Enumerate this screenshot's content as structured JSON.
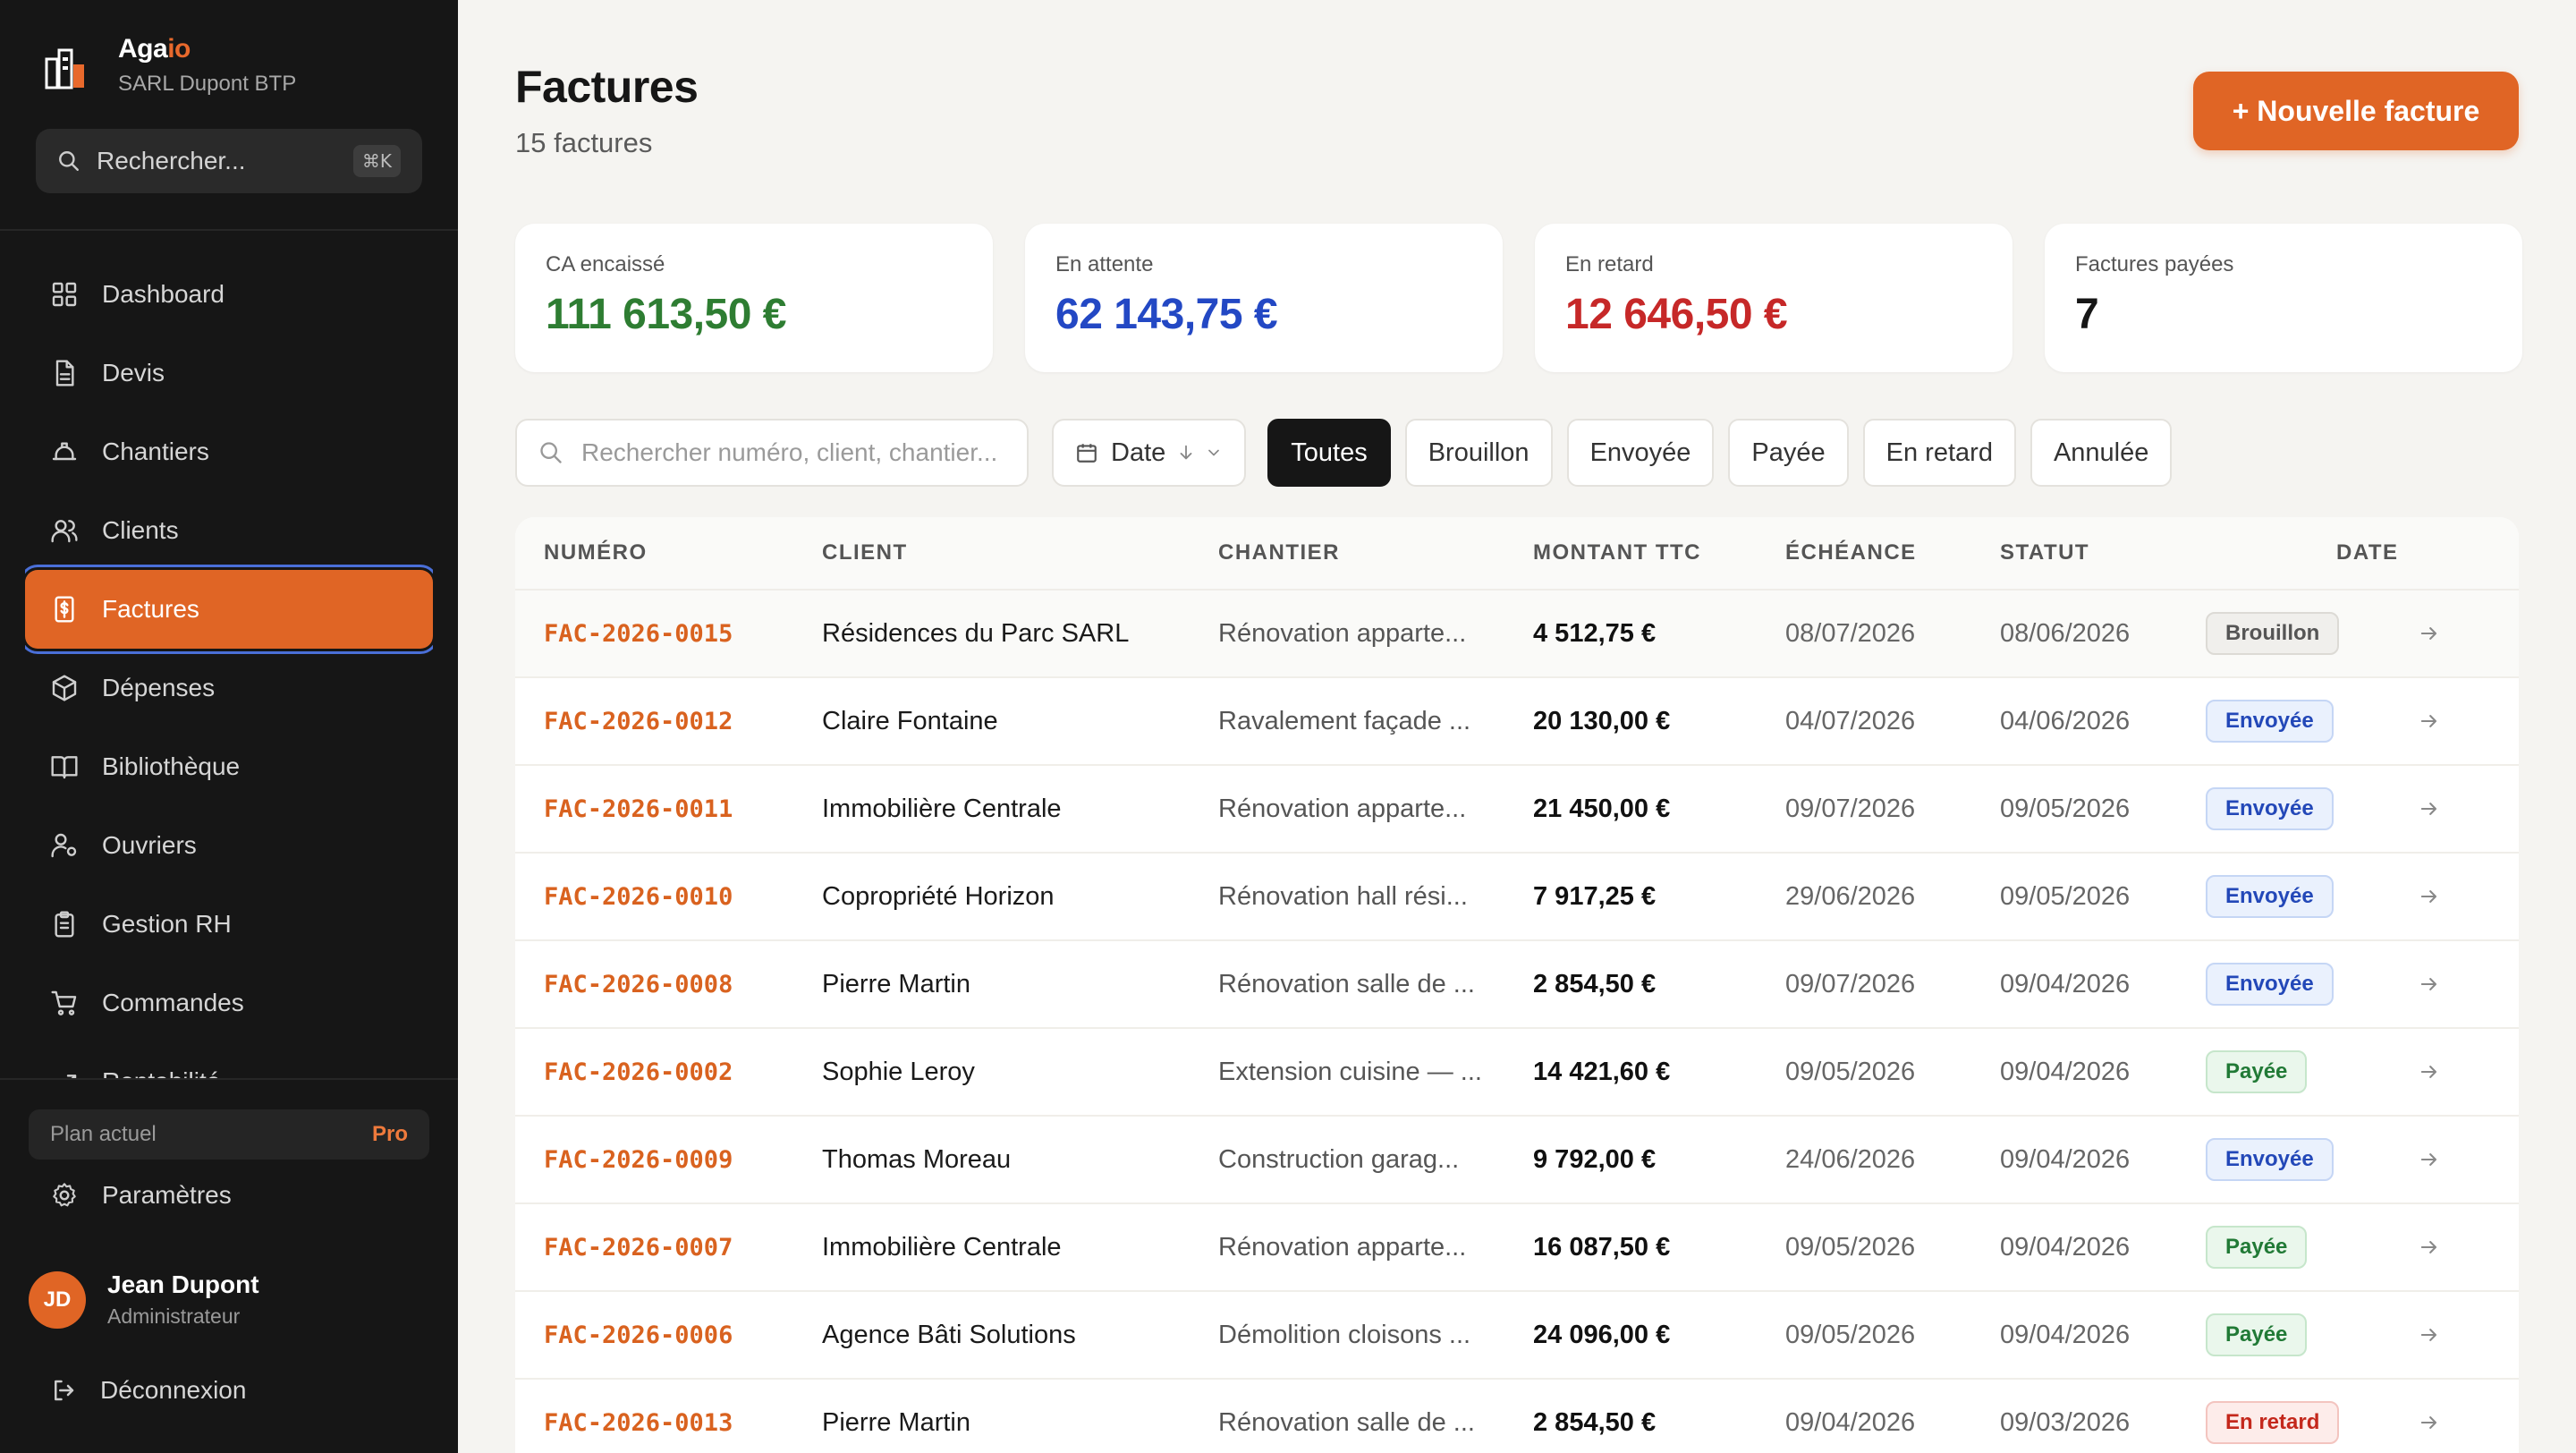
{
  "brand": {
    "name_main": "Aga",
    "name_accent": "io",
    "company": "SARL Dupont BTP"
  },
  "sidebar": {
    "search_label": "Rechercher...",
    "search_shortcut": "⌘K",
    "items": [
      {
        "label": "Dashboard",
        "icon": "grid-icon"
      },
      {
        "label": "Devis",
        "icon": "document-icon"
      },
      {
        "label": "Chantiers",
        "icon": "helmet-icon"
      },
      {
        "label": "Clients",
        "icon": "users-icon"
      },
      {
        "label": "Factures",
        "icon": "invoice-icon",
        "active": true
      },
      {
        "label": "Dépenses",
        "icon": "box-icon"
      },
      {
        "label": "Bibliothèque",
        "icon": "book-icon"
      },
      {
        "label": "Ouvriers",
        "icon": "worker-icon"
      },
      {
        "label": "Gestion RH",
        "icon": "clipboard-icon"
      },
      {
        "label": "Commandes",
        "icon": "cart-icon"
      },
      {
        "label": "Rentabilité",
        "icon": "chart-icon"
      }
    ],
    "plan_label": "Plan actuel",
    "plan_value": "Pro",
    "settings_label": "Paramètres",
    "user": {
      "initials": "JD",
      "name": "Jean Dupont",
      "role": "Administrateur"
    },
    "logout_label": "Déconnexion"
  },
  "header": {
    "title": "Factures",
    "subtitle": "15 factures",
    "new_button": "+ Nouvelle facture"
  },
  "stats": [
    {
      "label": "CA encaissé",
      "value": "111 613,50 €",
      "color": "#2e7d32"
    },
    {
      "label": "En attente",
      "value": "62 143,75 €",
      "color": "#2348c4"
    },
    {
      "label": "En retard",
      "value": "12 646,50 €",
      "color": "#c62828"
    },
    {
      "label": "Factures payées",
      "value": "7",
      "color": "#161616"
    }
  ],
  "filters": {
    "search_placeholder": "Rechercher numéro, client, chantier...",
    "date_label": "Date",
    "chips": [
      "Toutes",
      "Brouillon",
      "Envoyée",
      "Payée",
      "En retard",
      "Annulée"
    ],
    "active_chip": "Toutes"
  },
  "table": {
    "columns": [
      "NUMÉRO",
      "CLIENT",
      "CHANTIER",
      "MONTANT TTC",
      "ÉCHÉANCE",
      "STATUT",
      "DATE"
    ],
    "rows": [
      {
        "num": "FAC-2026-0015",
        "client": "Résidences du Parc SARL",
        "chantier": "Rénovation apparte...",
        "montant": "4 512,75 €",
        "echeance": "08/07/2026",
        "date": "08/06/2026",
        "statut": "Brouillon",
        "kind": "brouillon"
      },
      {
        "num": "FAC-2026-0012",
        "client": "Claire Fontaine",
        "chantier": "Ravalement façade ...",
        "montant": "20 130,00 €",
        "echeance": "04/07/2026",
        "date": "04/06/2026",
        "statut": "Envoyée",
        "kind": "envoyee"
      },
      {
        "num": "FAC-2026-0011",
        "client": "Immobilière Centrale",
        "chantier": "Rénovation apparte...",
        "montant": "21 450,00 €",
        "echeance": "09/07/2026",
        "date": "09/05/2026",
        "statut": "Envoyée",
        "kind": "envoyee"
      },
      {
        "num": "FAC-2026-0010",
        "client": "Copropriété Horizon",
        "chantier": "Rénovation hall rési...",
        "montant": "7 917,25 €",
        "echeance": "29/06/2026",
        "date": "09/05/2026",
        "statut": "Envoyée",
        "kind": "envoyee"
      },
      {
        "num": "FAC-2026-0008",
        "client": "Pierre Martin",
        "chantier": "Rénovation salle de ...",
        "montant": "2 854,50 €",
        "echeance": "09/07/2026",
        "date": "09/04/2026",
        "statut": "Envoyée",
        "kind": "envoyee"
      },
      {
        "num": "FAC-2026-0002",
        "client": "Sophie Leroy",
        "chantier": "Extension cuisine — ...",
        "montant": "14 421,60 €",
        "echeance": "09/05/2026",
        "date": "09/04/2026",
        "statut": "Payée",
        "kind": "payee"
      },
      {
        "num": "FAC-2026-0009",
        "client": "Thomas Moreau",
        "chantier": "Construction garag...",
        "montant": "9 792,00 €",
        "echeance": "24/06/2026",
        "date": "09/04/2026",
        "statut": "Envoyée",
        "kind": "envoyee"
      },
      {
        "num": "FAC-2026-0007",
        "client": "Immobilière Centrale",
        "chantier": "Rénovation apparte...",
        "montant": "16 087,50 €",
        "echeance": "09/05/2026",
        "date": "09/04/2026",
        "statut": "Payée",
        "kind": "payee"
      },
      {
        "num": "FAC-2026-0006",
        "client": "Agence Bâti Solutions",
        "chantier": "Démolition cloisons ...",
        "montant": "24 096,00 €",
        "echeance": "09/05/2026",
        "date": "09/04/2026",
        "statut": "Payée",
        "kind": "payee"
      },
      {
        "num": "FAC-2026-0013",
        "client": "Pierre Martin",
        "chantier": "Rénovation salle de ...",
        "montant": "2 854,50 €",
        "echeance": "09/04/2026",
        "date": "09/03/2026",
        "statut": "En retard",
        "kind": "retard"
      }
    ]
  }
}
